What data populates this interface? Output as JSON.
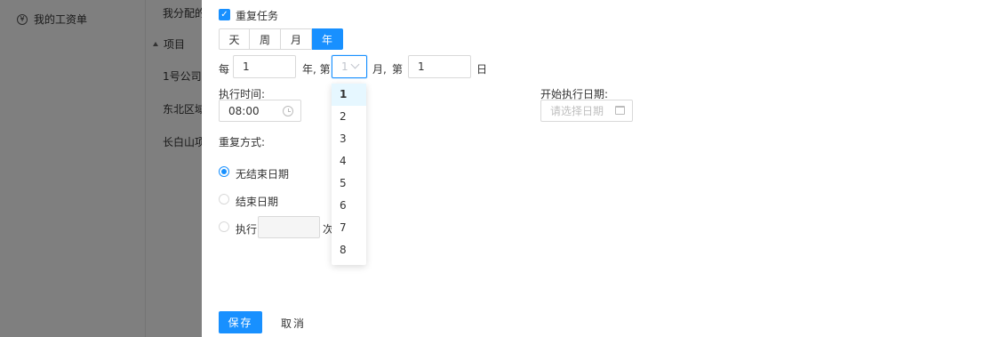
{
  "background": {
    "sidebar_item": "我的工资单",
    "tree": [
      "我分配的",
      "项目",
      "1号公司",
      "东北区域",
      "长白山项"
    ]
  },
  "form": {
    "repeat_task_label": "重复任务",
    "periods": [
      "天",
      "周",
      "月",
      "年"
    ],
    "active_period": "年",
    "every_label": "每",
    "every_value": "1",
    "year_nth_label": "年, 第",
    "month_select_value": "1",
    "month_label": "月,",
    "nth_label": "第",
    "day_value": "1",
    "day_label": "日",
    "exec_time_label": "执行时间:",
    "exec_time_value": "08:00",
    "start_date_label": "开始执行日期:",
    "start_date_placeholder": "请选择日期",
    "repeat_mode_label": "重复方式:",
    "options": [
      "无结束日期",
      "结束日期",
      "执行"
    ],
    "selected_option": "无结束日期",
    "times_suffix": "次",
    "dropdown_options": [
      "1",
      "2",
      "3",
      "4",
      "5",
      "6",
      "7",
      "8"
    ],
    "dropdown_selected": "1"
  },
  "actions": {
    "save": "保存",
    "cancel": "取消"
  },
  "colors": {
    "accent": "#1890ff",
    "mask": "rgba(0,0,0,0.5)"
  }
}
